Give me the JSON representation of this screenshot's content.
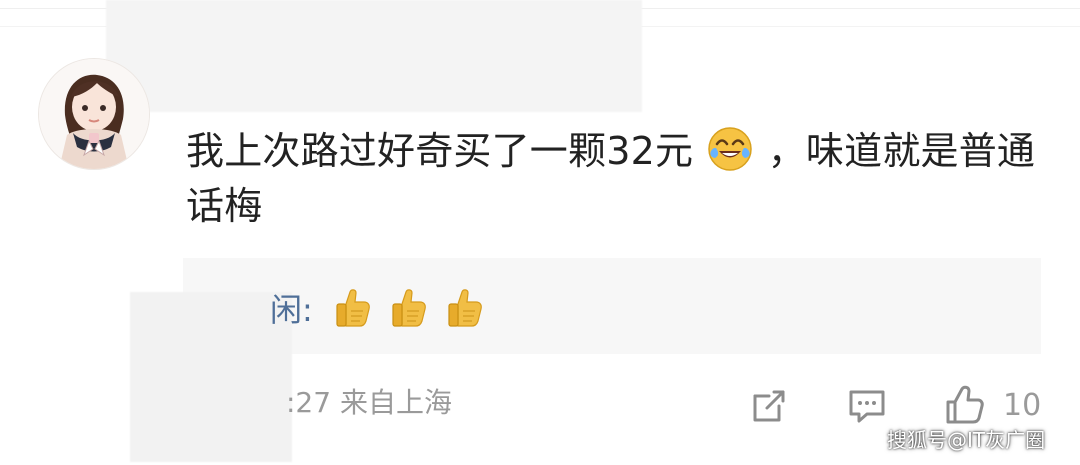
{
  "comment": {
    "text_before_emoji": "我上次路过好奇买了一颗32元",
    "text_after_emoji": "，味道就是普通话梅",
    "emoji": "laugh-cry-icon"
  },
  "reply": {
    "user_visible": "闲",
    "separator": ":",
    "emojis": [
      "thumbs-up-icon",
      "thumbs-up-icon",
      "thumbs-up-icon"
    ]
  },
  "meta": {
    "time_partial": ":27",
    "location": "来自上海"
  },
  "actions": {
    "share": "share-icon",
    "comment": "comment-icon",
    "like": "like-icon",
    "like_count": "10"
  },
  "watermark": "搜狐号@IT灰广圈",
  "colors": {
    "text_primary": "#222222",
    "reply_link": "#4f6f98",
    "meta_gray": "#9a9a9a",
    "reply_bg": "#f7f7f7"
  }
}
